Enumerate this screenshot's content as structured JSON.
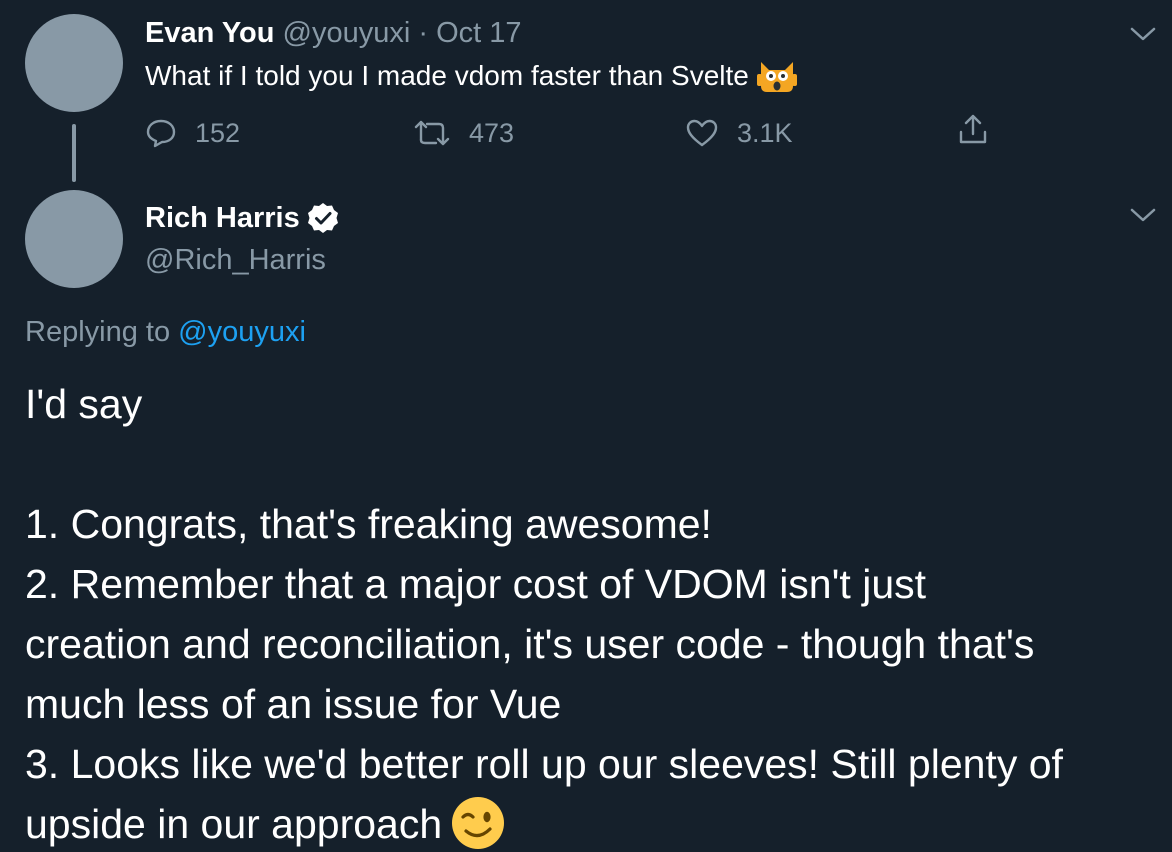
{
  "parent_tweet": {
    "name": "Evan You",
    "handle": "@youyuxi",
    "separator": "·",
    "date": "Oct 17",
    "text": "What if I told you I made vdom faster than Svelte",
    "emoji": "face-screaming-in-fear-cat",
    "actions": {
      "replies": "152",
      "retweets": "473",
      "likes": "3.1K"
    }
  },
  "reply_tweet": {
    "name": "Rich Harris",
    "verified": true,
    "handle": "@Rich_Harris",
    "replying_to_label": "Replying to",
    "replying_to_handle": "@youyuxi",
    "lines": [
      "I'd say",
      "1. Congrats, that's freaking awesome!",
      "2. Remember that a major cost of VDOM isn't just",
      "creation and reconciliation, it's user code - though that's",
      "much less of an issue for Vue",
      "3. Looks like we'd better roll up our sleeves! Still plenty of",
      "upside in our approach"
    ],
    "end_emoji": "winking-face"
  },
  "colors": {
    "background": "#15202b",
    "text": "#ffffff",
    "muted": "#8899a6",
    "accent": "#1da1f2"
  },
  "icons": [
    "reply-icon",
    "retweet-icon",
    "like-icon",
    "share-icon",
    "chevron-down-icon",
    "verified-badge-icon"
  ]
}
